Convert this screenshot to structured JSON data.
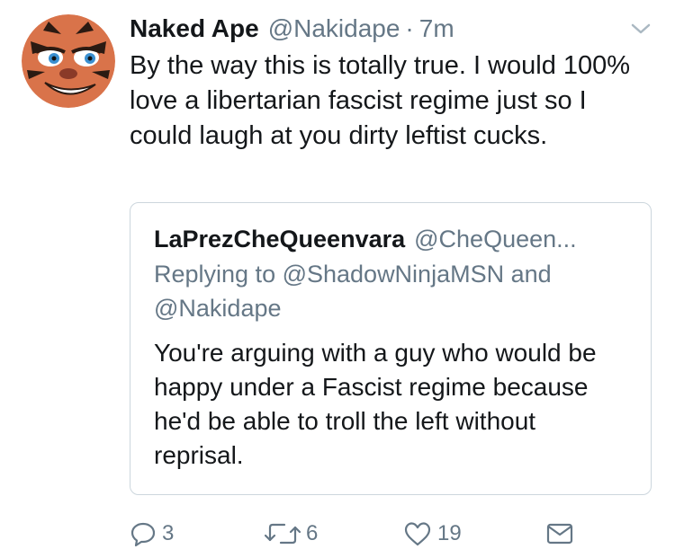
{
  "tweet": {
    "display_name": "Naked Ape",
    "handle": "@Nakidape",
    "separator": "·",
    "time": "7m",
    "text": "By the way this is totally true. I would 100% love a libertarian fascist regime just so I could laugh at you dirty leftist cucks.",
    "avatar_icon": "tiger-face-icon",
    "menu_icon": "chevron-down-icon"
  },
  "quote": {
    "display_name": "LaPrezCheQueenvara",
    "handle": "@CheQueen...",
    "replying_to": "Replying to @ShadowNinjaMSN and @Nakidape",
    "text": "You're arguing with a guy who would be happy under a Fascist regime because he'd be able to troll the left without reprisal."
  },
  "actions": {
    "reply": {
      "icon": "reply-icon",
      "count": "3"
    },
    "retweet": {
      "icon": "retweet-icon",
      "count": "6"
    },
    "like": {
      "icon": "heart-icon",
      "count": "19"
    },
    "message": {
      "icon": "envelope-icon"
    }
  },
  "colors": {
    "text": "#14171a",
    "secondary": "#657786",
    "border": "#ccd6dd",
    "avatar_orange": "#d9734a"
  }
}
